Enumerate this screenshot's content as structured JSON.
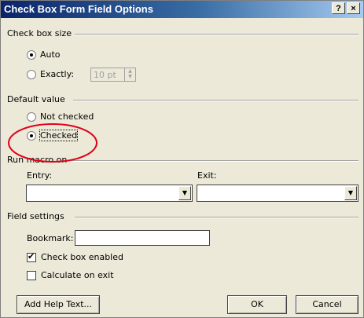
{
  "window": {
    "title": "Check Box Form Field Options",
    "help_glyph": "?",
    "close_glyph": "×"
  },
  "check_box_size": {
    "group_label": "Check box size",
    "auto_label": "Auto",
    "exactly_label": "Exactly:",
    "exactly_value": "10 pt",
    "selected": "auto"
  },
  "default_value": {
    "group_label": "Default value",
    "not_checked_label": "Not checked",
    "checked_label": "Checked",
    "selected": "checked"
  },
  "run_macro": {
    "group_label": "Run macro on",
    "entry_label": "Entry:",
    "exit_label": "Exit:",
    "entry_value": "",
    "exit_value": ""
  },
  "field_settings": {
    "group_label": "Field settings",
    "bookmark_label": "Bookmark:",
    "bookmark_value": "",
    "check_box_enabled_label": "Check box enabled",
    "check_box_enabled": true,
    "calculate_on_exit_label": "Calculate on exit",
    "calculate_on_exit": false
  },
  "buttons": {
    "add_help_text": "Add Help Text...",
    "ok": "OK",
    "cancel": "Cancel"
  },
  "annotation": {
    "color": "#e0001b"
  }
}
